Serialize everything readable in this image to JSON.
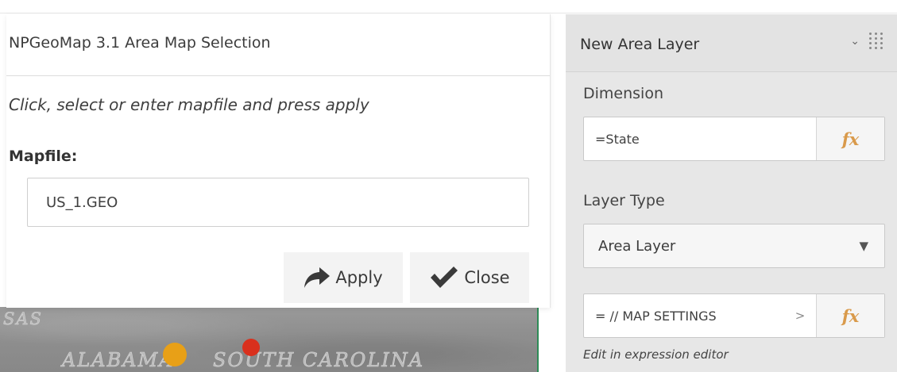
{
  "dialog": {
    "title": "NPGeoMap 3.1 Area Map Selection",
    "instruction": "Click, select or enter mapfile and press apply",
    "mapfile_label": "Mapfile:",
    "mapfile_value": "US_1.GEO",
    "apply_label": "Apply",
    "close_label": "Close"
  },
  "map": {
    "labels": {
      "sas": "SAS",
      "alabama": "ALABAMA",
      "south_carolina": "SOUTH CAROLINA"
    },
    "colors": {
      "orange_marker": "#e8a017",
      "red_marker": "#d9301d",
      "border": "#2e8b57"
    }
  },
  "panel": {
    "title": "New Area Layer",
    "dimension_label": "Dimension",
    "dimension_value": "=State",
    "layer_type_label": "Layer Type",
    "layer_type_value": "Area Layer",
    "settings_value": "= // MAP SETTINGS",
    "settings_more": ">",
    "fx_label": "fx",
    "expression_hint": "Edit in expression editor",
    "icons": {
      "collapse": "chevron-down-icon",
      "drag": "drag-grid-icon",
      "apply": "share-arrow-icon",
      "close": "checkmark-icon"
    }
  }
}
